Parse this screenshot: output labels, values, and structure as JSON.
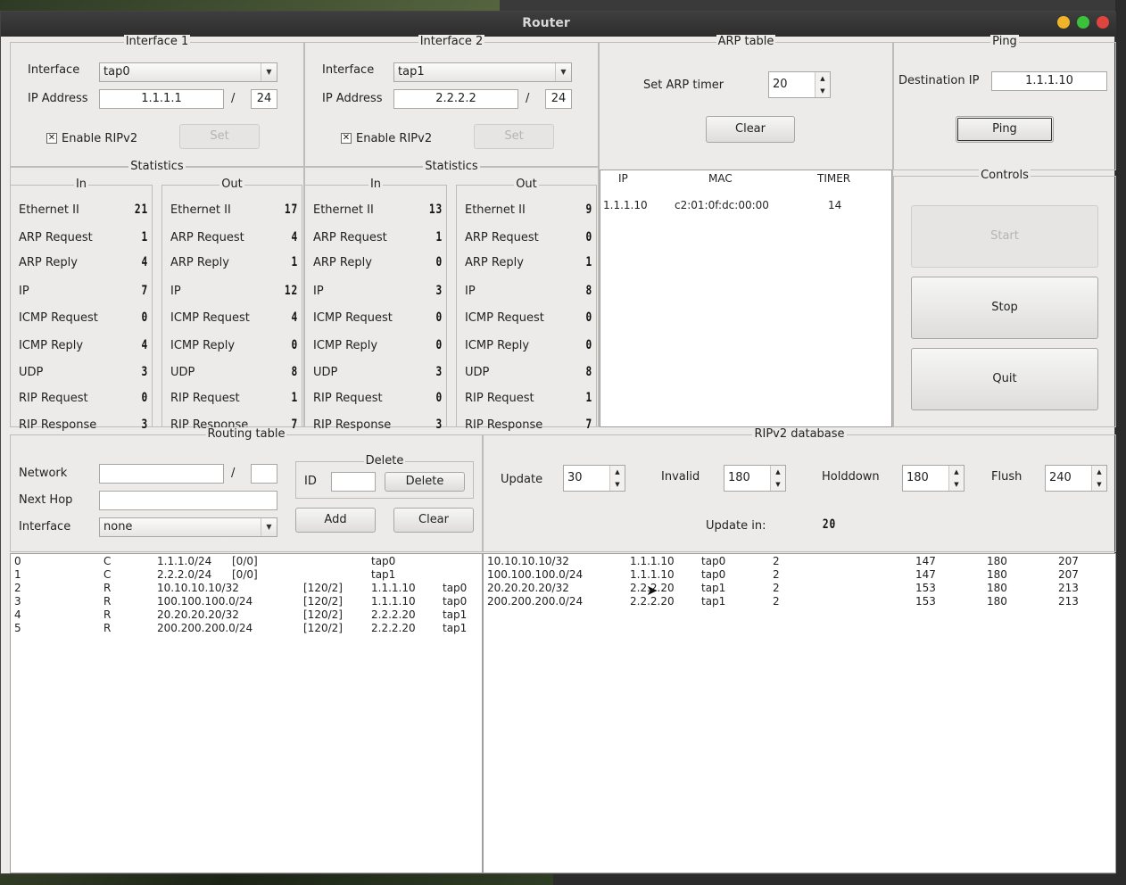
{
  "window": {
    "title": "Router"
  },
  "iface1": {
    "title": "Interface 1",
    "interface_label": "Interface",
    "interface_value": "tap0",
    "ip_label": "IP Address",
    "ip_value": "1.1.1.1",
    "slash": "/",
    "mask": "24",
    "ripv2_label": "Enable RIPv2",
    "ripv2_checked": "✕",
    "set_label": "Set"
  },
  "iface2": {
    "title": "Interface 2",
    "interface_label": "Interface",
    "interface_value": "tap1",
    "ip_label": "IP Address",
    "ip_value": "2.2.2.2",
    "slash": "/",
    "mask": "24",
    "ripv2_label": "Enable RIPv2",
    "ripv2_checked": "✕",
    "set_label": "Set"
  },
  "stats": {
    "title": "Statistics",
    "in_label": "In",
    "out_label": "Out",
    "labels": [
      "Ethernet II",
      "ARP Request",
      "ARP Reply",
      "IP",
      "ICMP Request",
      "ICMP Reply",
      "UDP",
      "RIP Request",
      "RIP Response"
    ],
    "if1_in": [
      "21",
      "1",
      "4",
      "7",
      "0",
      "4",
      "3",
      "0",
      "3"
    ],
    "if1_out": [
      "17",
      "4",
      "1",
      "12",
      "4",
      "0",
      "8",
      "1",
      "7"
    ],
    "if2_in": [
      "13",
      "1",
      "0",
      "3",
      "0",
      "0",
      "3",
      "0",
      "3"
    ],
    "if2_out": [
      "9",
      "0",
      "1",
      "8",
      "0",
      "0",
      "8",
      "1",
      "7"
    ]
  },
  "arp": {
    "title": "ARP table",
    "timer_label": "Set ARP timer",
    "timer_value": "20",
    "clear_label": "Clear",
    "headers": [
      "IP",
      "MAC",
      "TIMER"
    ],
    "rows": [
      {
        "ip": "1.1.1.10",
        "mac": "c2:01:0f:dc:00:00",
        "timer": "14"
      }
    ]
  },
  "ping": {
    "title": "Ping",
    "dest_label": "Destination IP",
    "dest_value": "1.1.1.10",
    "button": "Ping"
  },
  "controls": {
    "title": "Controls",
    "start": "Start",
    "stop": "Stop",
    "quit": "Quit"
  },
  "routing": {
    "title": "Routing table",
    "network_label": "Network",
    "slash": "/",
    "network_value": "",
    "mask_value": "",
    "nexthop_label": "Next Hop",
    "nexthop_value": "",
    "interface_label": "Interface",
    "interface_value": "none",
    "delete_group": "Delete",
    "id_label": "ID",
    "id_value": "",
    "delete_btn": "Delete",
    "add_btn": "Add",
    "clear_btn": "Clear",
    "rows": [
      [
        "0",
        "C",
        "1.1.1.0/24",
        "[0/0]",
        "",
        "tap0",
        ""
      ],
      [
        "1",
        "C",
        "2.2.2.0/24",
        "[0/0]",
        "",
        "tap1",
        ""
      ],
      [
        "2",
        "R",
        "10.10.10.10/32",
        "",
        "[120/2]",
        "1.1.1.10",
        "tap0"
      ],
      [
        "3",
        "R",
        "100.100.100.0/24",
        "",
        "[120/2]",
        "1.1.1.10",
        "tap0"
      ],
      [
        "4",
        "R",
        "20.20.20.20/32",
        "",
        "[120/2]",
        "2.2.2.20",
        "tap1"
      ],
      [
        "5",
        "R",
        "200.200.200.0/24",
        "",
        "[120/2]",
        "2.2.2.20",
        "tap1"
      ]
    ]
  },
  "rip": {
    "title": "RIPv2 database",
    "update_label": "Update",
    "update_value": "30",
    "invalid_label": "Invalid",
    "invalid_value": "180",
    "holddown_label": "Holddown",
    "holddown_value": "180",
    "flush_label": "Flush",
    "flush_value": "240",
    "update_in_label": "Update in:",
    "update_in_value": "20",
    "rows": [
      [
        "10.10.10.10/32",
        "1.1.1.10",
        "tap0",
        "2",
        "147",
        "180",
        "207"
      ],
      [
        "100.100.100.0/24",
        "1.1.1.10",
        "tap0",
        "2",
        "147",
        "180",
        "207"
      ],
      [
        "20.20.20.20/32",
        "2.2.2.20",
        "tap1",
        "2",
        "153",
        "180",
        "213"
      ],
      [
        "200.200.200.0/24",
        "2.2.2.20",
        "tap1",
        "2",
        "153",
        "180",
        "213"
      ]
    ]
  },
  "colors": {
    "close": "#e0443e",
    "minimize": "#f0b429",
    "maximize": "#3cc13b"
  }
}
